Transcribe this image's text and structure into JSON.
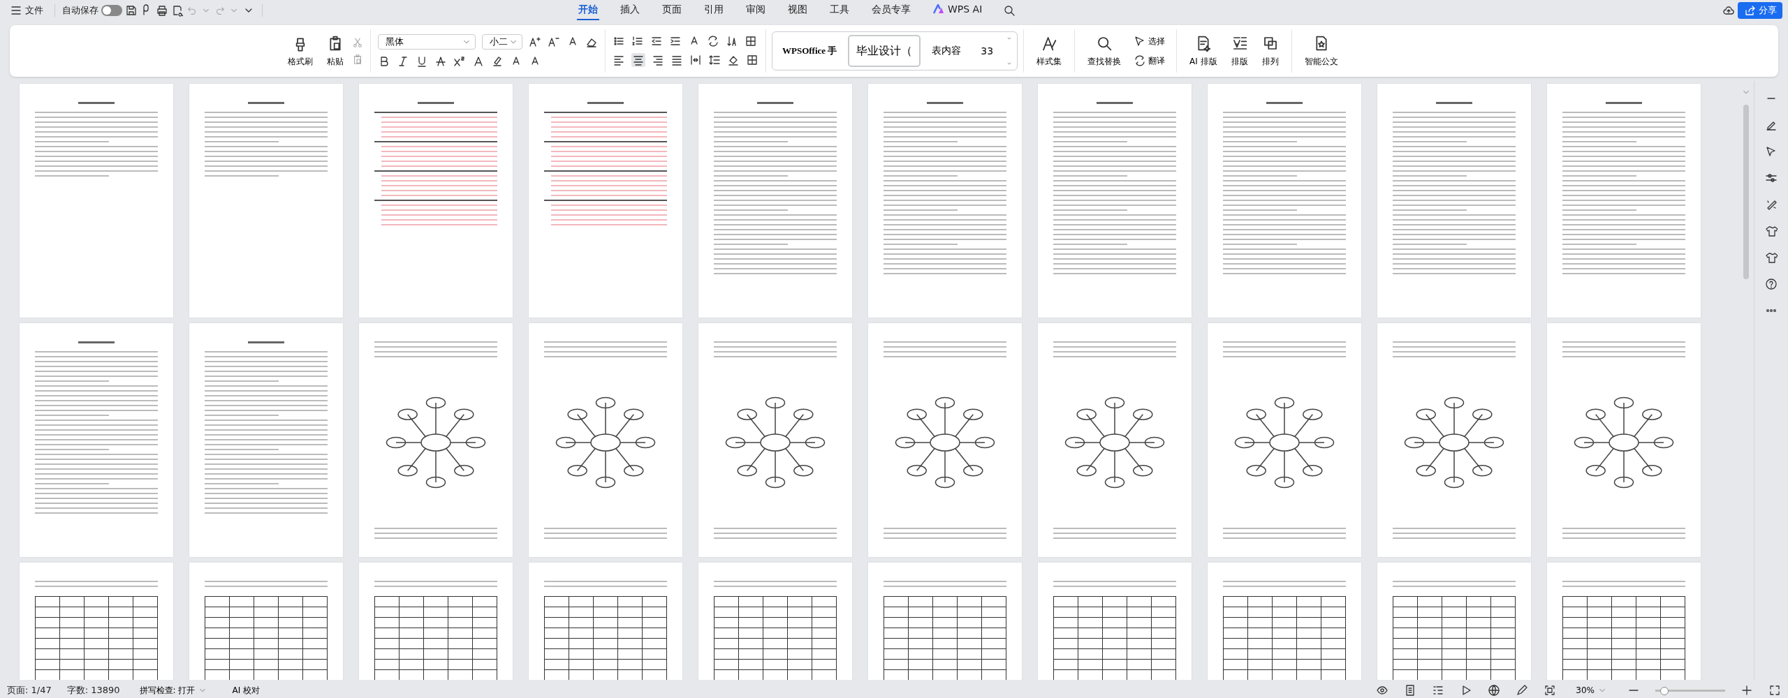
{
  "menu": {
    "label": "文件"
  },
  "autosave": {
    "label": "自动保存",
    "on": false
  },
  "tabs": [
    {
      "label": "开始",
      "selected": true
    },
    {
      "label": "插入",
      "selected": false
    },
    {
      "label": "页面",
      "selected": false
    },
    {
      "label": "引用",
      "selected": false
    },
    {
      "label": "审阅",
      "selected": false
    },
    {
      "label": "视图",
      "selected": false
    },
    {
      "label": "工具",
      "selected": false
    },
    {
      "label": "会员专享",
      "selected": false
    },
    {
      "label": "WPS AI",
      "selected": false
    }
  ],
  "share": "分享",
  "ribbon": {
    "format_painter": "格式刷",
    "paste": "粘贴",
    "font": "黑体",
    "size": "小二",
    "styles": [
      {
        "label": "WPSOffice 手",
        "selected": false
      },
      {
        "label": "毕业设计（",
        "selected": true
      },
      {
        "label": "表内容",
        "selected": false
      },
      {
        "label": "33",
        "selected": false
      }
    ],
    "style_set": "样式集",
    "find": "查找替换",
    "select": "选择",
    "translate": "翻译",
    "ai_layout": "AI 排版",
    "layout": "排版",
    "arrange": "排列",
    "smart_doc": "智能公文"
  },
  "pages": [
    {
      "kind": "text"
    },
    {
      "kind": "text"
    },
    {
      "kind": "toc"
    },
    {
      "kind": "toc"
    },
    {
      "kind": "text"
    },
    {
      "kind": "text"
    },
    {
      "kind": "text"
    },
    {
      "kind": "text"
    },
    {
      "kind": "text"
    },
    {
      "kind": "text"
    },
    {
      "kind": "text"
    },
    {
      "kind": "text"
    },
    {
      "kind": "diagram"
    },
    {
      "kind": "diagram"
    },
    {
      "kind": "diagram"
    },
    {
      "kind": "diagram"
    },
    {
      "kind": "diagram"
    },
    {
      "kind": "diagram"
    },
    {
      "kind": "diagram"
    },
    {
      "kind": "diagram"
    },
    {
      "kind": "table"
    },
    {
      "kind": "table"
    },
    {
      "kind": "table"
    },
    {
      "kind": "table"
    },
    {
      "kind": "table"
    },
    {
      "kind": "table"
    },
    {
      "kind": "table"
    },
    {
      "kind": "table"
    },
    {
      "kind": "table"
    },
    {
      "kind": "table"
    }
  ],
  "status": {
    "page": "页面: 1/47",
    "words": "字数: 13890",
    "spell": "拼写检查: 打开",
    "ai_check": "AI 校对",
    "zoom": "30%"
  }
}
